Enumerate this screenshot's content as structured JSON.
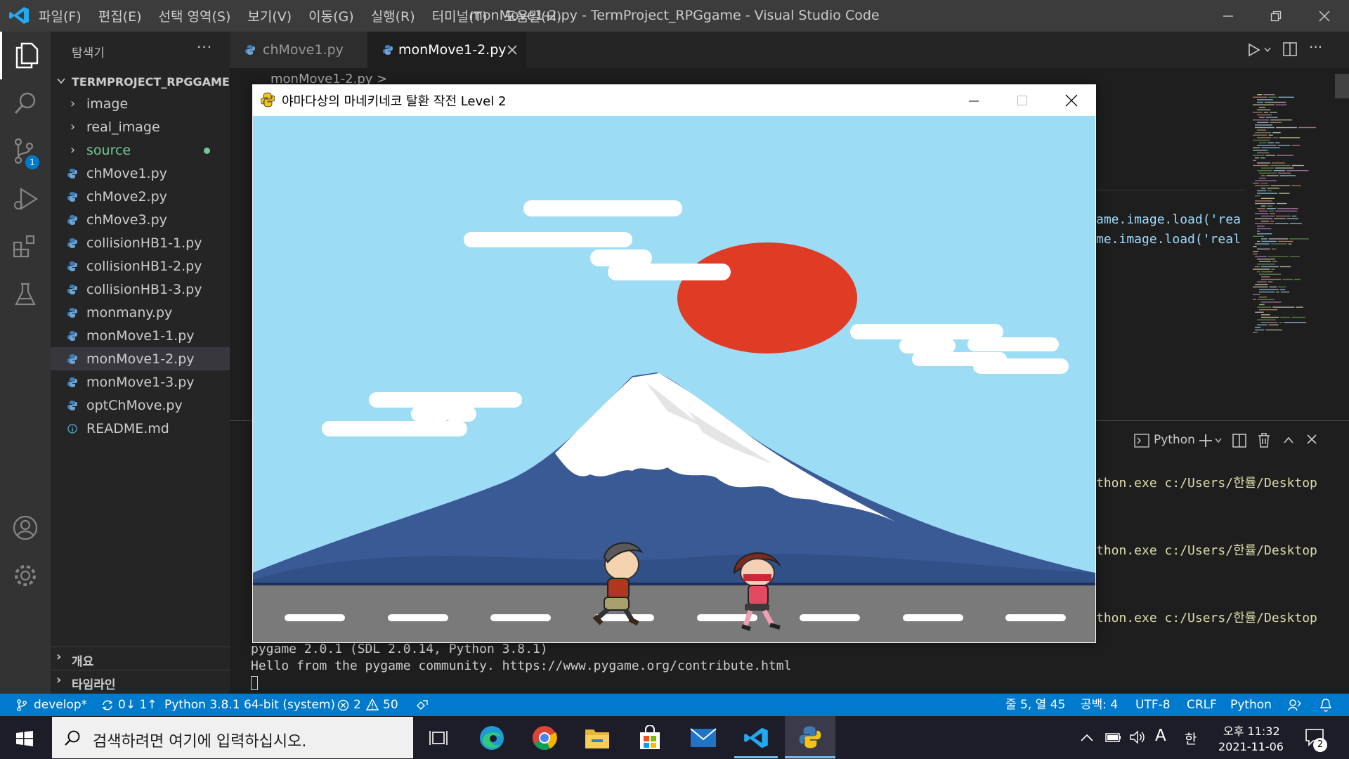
{
  "titlebar": {
    "menus": [
      "파일(F)",
      "편집(E)",
      "선택 영역(S)",
      "보기(V)",
      "이동(G)",
      "실행(R)",
      "터미널(T)",
      "도움말(H)"
    ],
    "title": "monMove1-2.py - TermProject_RPGgame - Visual Studio Code"
  },
  "sidebar": {
    "title": "탐색기",
    "more": "···",
    "project": "TERMPROJECT_RPGGAME",
    "folders": [
      "image",
      "real_image",
      "source"
    ],
    "files": [
      "chMove1.py",
      "chMove2.py",
      "chMove3.py",
      "collisionHB1-1.py",
      "collisionHB1-2.py",
      "collisionHB1-3.py",
      "monmany.py",
      "monMove1-1.py",
      "monMove1-2.py",
      "monMove1-3.py",
      "optChMove.py",
      "README.md"
    ],
    "outline": "개요",
    "timeline": "타임라인"
  },
  "scm_badge": "1",
  "tabs": [
    "chMove1.py",
    "monMove1-2.py"
  ],
  "breadcrumb": "monMove1-2.py >",
  "code_lines": [
    "ame.image.load('rea",
    "me.image.load('real"
  ],
  "terminal": {
    "shell": "Python",
    "lines": [
      "thon.exe c:/Users/한률/Desktop",
      "thon.exe c:/Users/한률/Desktop",
      "thon.exe c:/Users/한률/Desktop"
    ],
    "out1": "pygame 2.0.1 (SDL 2.0.14, Python 3.8.1)",
    "out2": "Hello from the pygame community. https://www.pygame.org/contribute.html"
  },
  "game": {
    "title": "야마다상의 마네키네코 탈환 작전 Level 2"
  },
  "statusbar": {
    "branch": "develop*",
    "sync": "0↓ 1↑",
    "interpreter": "Python 3.8.1 64-bit (system)",
    "errors": "2",
    "warnings": "50",
    "position": "줄 5, 열 45",
    "spaces": "공백: 4",
    "encoding": "UTF-8",
    "eol": "CRLF",
    "language": "Python"
  },
  "taskbar": {
    "search_placeholder": "검색하려면 여기에 입력하십시오.",
    "time_prefix": "오후 11:32",
    "date": "2021-11-06",
    "ime": "A",
    "ime2": "한",
    "notify_count": "2"
  },
  "colors": {
    "accent": "#007acc",
    "sky": "#9ddcf5",
    "sun": "#e03b24",
    "mountain": "#3a5a96",
    "road": "#7a7a7a"
  }
}
